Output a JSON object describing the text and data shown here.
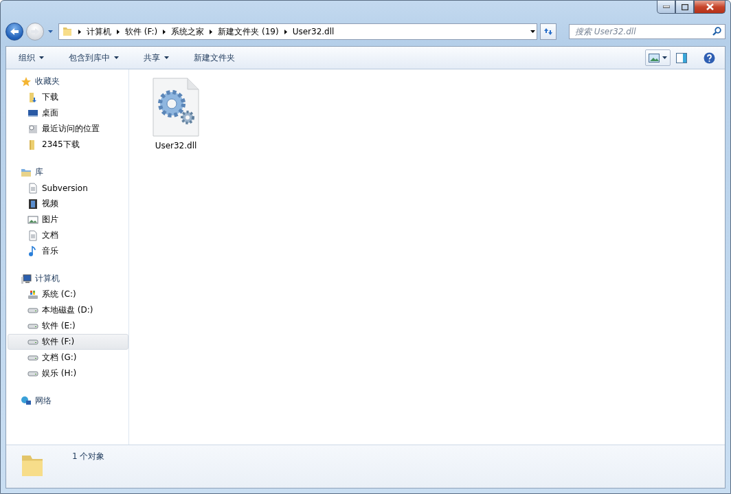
{
  "breadcrumb": [
    "计算机",
    "软件 (F:)",
    "系统之家",
    "新建文件夹 (19)",
    "User32.dll"
  ],
  "search": {
    "placeholder": "搜索 User32.dll"
  },
  "toolbar": [
    {
      "label": "组织",
      "dropdown": true
    },
    {
      "label": "包含到库中",
      "dropdown": true
    },
    {
      "label": "共享",
      "dropdown": true
    },
    {
      "label": "新建文件夹",
      "dropdown": false
    }
  ],
  "sidebar": [
    {
      "label": "收藏夹",
      "kind": "star",
      "children": [
        {
          "label": "下载",
          "kind": "download",
          "selected": false
        },
        {
          "label": "桌面",
          "kind": "desktop",
          "selected": false
        },
        {
          "label": "最近访问的位置",
          "kind": "recent",
          "selected": false
        },
        {
          "label": "2345下载",
          "kind": "folder",
          "selected": false
        }
      ]
    },
    {
      "label": "库",
      "kind": "library",
      "children": [
        {
          "label": "Subversion",
          "kind": "doc",
          "selected": false
        },
        {
          "label": "视频",
          "kind": "video",
          "selected": false
        },
        {
          "label": "图片",
          "kind": "picture",
          "selected": false
        },
        {
          "label": "文档",
          "kind": "doc",
          "selected": false
        },
        {
          "label": "音乐",
          "kind": "music",
          "selected": false
        }
      ]
    },
    {
      "label": "计算机",
      "kind": "computer",
      "children": [
        {
          "label": "系统 (C:)",
          "kind": "sysdrive",
          "selected": false
        },
        {
          "label": "本地磁盘 (D:)",
          "kind": "drive",
          "selected": false
        },
        {
          "label": "软件 (E:)",
          "kind": "drive",
          "selected": false
        },
        {
          "label": "软件 (F:)",
          "kind": "drive",
          "selected": true
        },
        {
          "label": "文档 (G:)",
          "kind": "drive",
          "selected": false
        },
        {
          "label": "娱乐 (H:)",
          "kind": "drive",
          "selected": false
        }
      ]
    },
    {
      "label": "网络",
      "kind": "network"
    }
  ],
  "files": [
    {
      "name": "User32.dll"
    }
  ],
  "status_bar": {
    "text": "1 个对象"
  }
}
